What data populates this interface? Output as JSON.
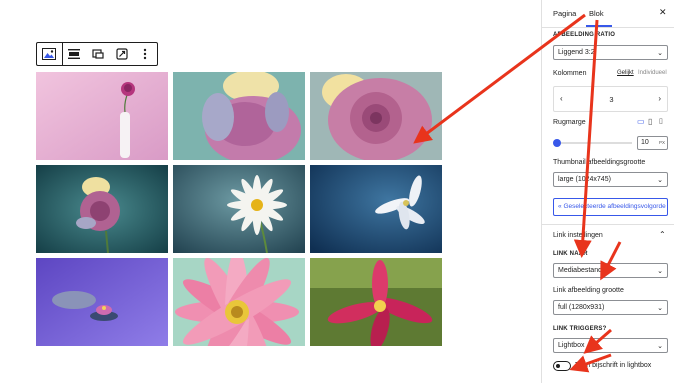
{
  "block_toolbar": {
    "icons": [
      "gallery-icon",
      "align-icon",
      "crop-icon",
      "replace-image-icon",
      "more-options-icon"
    ]
  },
  "gallery": {
    "images": [
      {
        "name": "pink-flower-in-vase",
        "bg": "#e9b7d6"
      },
      {
        "name": "pink-rose-closeup-teal",
        "bg": "#7ab0ad"
      },
      {
        "name": "pink-rose-dew",
        "bg": "#c98aa8"
      },
      {
        "name": "pink-rose-teal-background",
        "bg": "#2e6268"
      },
      {
        "name": "white-daisy",
        "bg": "#3f6a7a"
      },
      {
        "name": "white-lily-blue",
        "bg": "#1c4a73"
      },
      {
        "name": "water-lily-purple",
        "bg": "#6c5ad0"
      },
      {
        "name": "pink-daisy-closeup",
        "bg": "#a9d4c6"
      },
      {
        "name": "red-lily",
        "bg": "#4e6b2a"
      }
    ]
  },
  "sidebar": {
    "tabs": {
      "page": "Pagina",
      "block": "Blok"
    },
    "close_icon": "close-icon",
    "aspect_ratio": {
      "label": "AFBEELDING RATIO",
      "value": "Liggend 3:2"
    },
    "columns": {
      "label": "Kolommen",
      "equal": "Gelijkt",
      "individual": "Individueel",
      "value": "3"
    },
    "margin": {
      "label": "Rugmarge",
      "value": "10",
      "unit": "PX"
    },
    "thumbnail": {
      "label": "Thumbnail afbeeldingsgrootte",
      "value": "large (1024x745)"
    },
    "reorder_button": "Geselecteerde afbeeldingsvolgorde",
    "link_settings": {
      "title": "Link instellingen",
      "link_to_label": "LINK NAAR",
      "link_to_value": "Mediabestand",
      "image_size_label": "Link afbeelding grootte",
      "image_size_value": "full (1280x931)",
      "trigger_label": "LINK TRIGGERS?",
      "trigger_value": "Lightbox",
      "caption_toggle_label": "Toon bijschrift in lightbox"
    }
  },
  "colors": {
    "accent": "#3858e9",
    "arrow": "#e8341c",
    "border": "#1e1e1e"
  }
}
